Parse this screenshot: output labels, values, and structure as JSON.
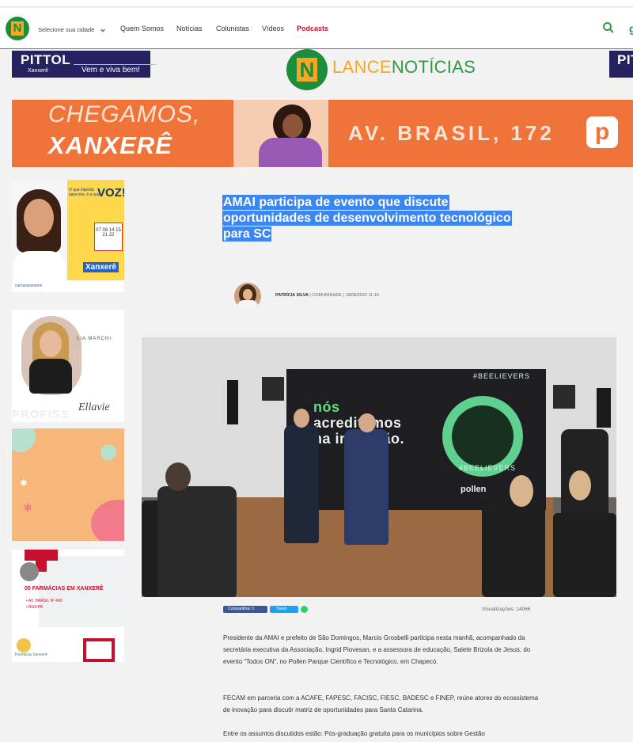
{
  "nav": {
    "city_label": "Selecione sua cidade",
    "links": [
      "Quem Somos",
      "Notícias",
      "Colunistas",
      "Vídeos",
      "Podcasts"
    ]
  },
  "ads": {
    "pittol": {
      "brand": "PITTOL",
      "town": "Xanxerê",
      "slogan": "Vem e viva bem!"
    },
    "pittol_right": {
      "brand": "PITT"
    },
    "banner": {
      "line1": "CHEGAMOS,",
      "line2": "XANXERÊ",
      "address": "AV. BRASIL, 172",
      "logo": "p"
    },
    "camara": {
      "voz": "VOZ!",
      "question": "O que importa para nós, é a sua",
      "cal": "07 08 14 15 21 22",
      "city": "Xanxerê",
      "footer": "camaraxanxere"
    },
    "lia": {
      "name": "LIA MARCHI",
      "text": "……",
      "signature": "Ellavie",
      "bottom": "PROFISS"
    },
    "farmacia": {
      "headline": "05 FARMÁCIAS EM XANXERÊ",
      "line1": "• AV. BRASIL Nº 400",
      "line2": "• RUA PA",
      "brand": "Farmácia Xanxerê"
    }
  },
  "logo": {
    "part1": "LANCE",
    "part2": "NOTÍCIAS"
  },
  "article": {
    "title": "AMAI participa de evento que discute oportunidades de desenvolvimento tecnológico para SC",
    "author": "PATRÍCIA SILVA",
    "category": "COMUNIDADE",
    "date": "18/08/2022 11:15",
    "share_fb": "Compartilhar 3",
    "share_tw": "Tweet",
    "views": "Visualizações: 14066",
    "paragraphs": [
      "Presidente da AMAI e prefeito de São Domingos, Marcio Grosbelli participa nesta manhã, acompanhado da secretária executiva da Associação, Ingrid Piovesan, e a assessora de educação, Salete Brizola de Jesus, do evento “Todos ON”, no Pollen Parque Científico e Tecnológico, em Chapecó.",
      "FECAM em parceria com a ACAFE, FAPESC, FACISC, FIESC, BADESC e FINEP, reúne atores do ecossistema de inovação para discutir matriz de oportunidades para Santa Catarina.",
      "Entre os assuntos discutidos estão: Pós-graduação gratuita para os municípios sobre Gestão"
    ]
  },
  "photo": {
    "screen_line1": "nós",
    "screen_line2": "acreditamos",
    "screen_line3": "na inovação.",
    "badge_top": "#BEELIEVERS",
    "badge_bottom": "#BEELIEVERS",
    "brand": "pollen"
  }
}
